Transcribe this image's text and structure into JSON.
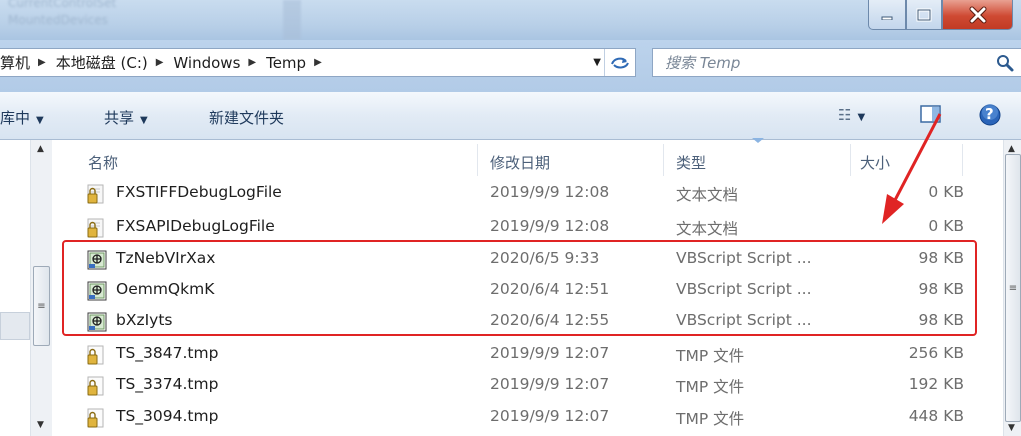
{
  "window": {
    "blurred_text_1": "CurrentControlSet",
    "blurred_text_2": "MountedDevices",
    "minimize_glyph": "—",
    "close_glyph": "X"
  },
  "address": {
    "crumbs": [
      "算机",
      "本地磁盘 (C:)",
      "Windows",
      "Temp"
    ],
    "separator": "▶",
    "dropdown_glyph": "▼",
    "refresh_glyph": "⟳"
  },
  "search": {
    "placeholder": "搜索 Temp"
  },
  "commandbar": {
    "include_label": "库中",
    "share_label": "共享",
    "new_folder_label": "新建文件夹",
    "arrow_glyph": "▼",
    "view_glyph": "☷",
    "help_glyph": "?"
  },
  "columns": {
    "name": "名称",
    "date": "修改日期",
    "type": "类型",
    "size": "大小"
  },
  "files": [
    {
      "name": "FXSTIFFDebugLogFile",
      "date": "2019/9/9 12:08",
      "type": "文本文档",
      "size": "0 KB",
      "icon": "locked-text-file-icon"
    },
    {
      "name": "FXSAPIDebugLogFile",
      "date": "2019/9/9 12:08",
      "type": "文本文档",
      "size": "0 KB",
      "icon": "locked-text-file-icon"
    },
    {
      "name": "TzNebVIrXax",
      "date": "2020/6/5 9:33",
      "type": "VBScript Script ...",
      "size": "98 KB",
      "icon": "vbscript-file-icon"
    },
    {
      "name": "OemmQkmK",
      "date": "2020/6/4 12:51",
      "type": "VBScript Script ...",
      "size": "98 KB",
      "icon": "vbscript-file-icon"
    },
    {
      "name": "bXzIyts",
      "date": "2020/6/4 12:55",
      "type": "VBScript Script ...",
      "size": "98 KB",
      "icon": "vbscript-file-icon"
    },
    {
      "name": "TS_3847.tmp",
      "date": "2019/9/9 12:07",
      "type": "TMP 文件",
      "size": "256 KB",
      "icon": "locked-file-icon"
    },
    {
      "name": "TS_3374.tmp",
      "date": "2019/9/9 12:07",
      "type": "TMP 文件",
      "size": "192 KB",
      "icon": "locked-file-icon"
    },
    {
      "name": "TS_3094.tmp",
      "date": "2019/9/9 12:07",
      "type": "TMP 文件",
      "size": "448 KB",
      "icon": "locked-file-icon"
    }
  ],
  "annotation": {
    "highlight_color": "#e02424",
    "arrow_color": "#e02424"
  },
  "scrollbar": {
    "up_glyph": "▲",
    "down_glyph": "▼",
    "grip_glyph": "≡"
  }
}
